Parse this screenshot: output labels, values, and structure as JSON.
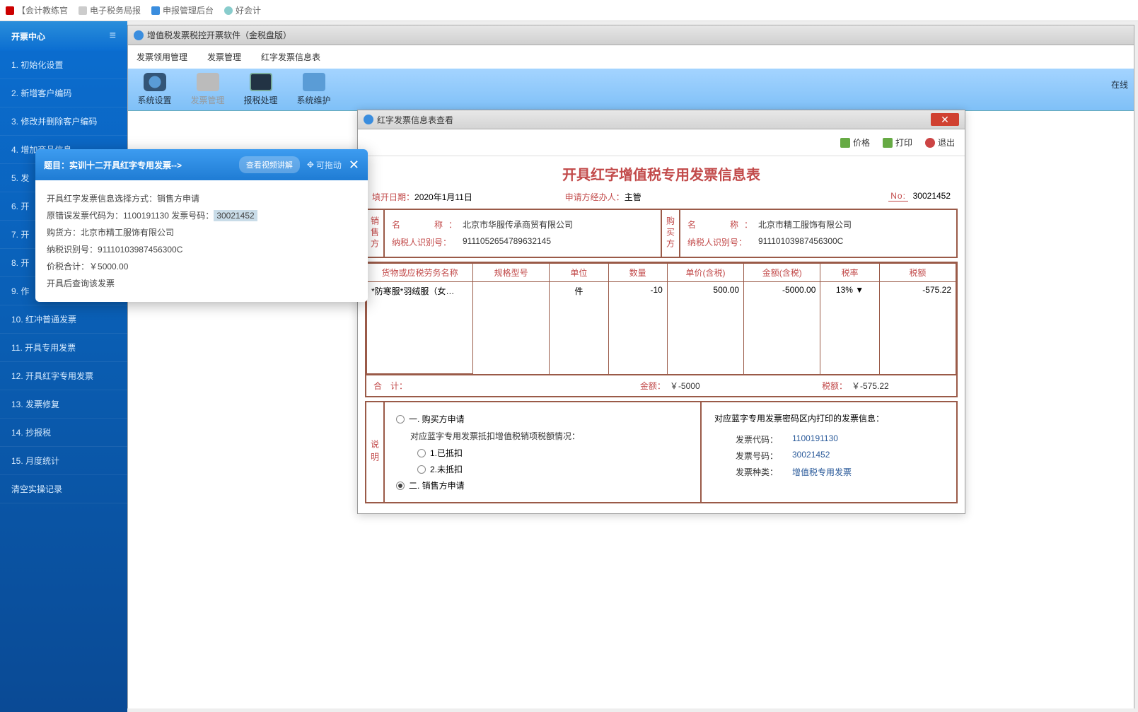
{
  "browserTabs": [
    "【会计教练官",
    "电子税务局报",
    "申报管理后台",
    "好会计"
  ],
  "sidebar": {
    "title": "开票中心",
    "items": [
      "1. 初始化设置",
      "2. 新增客户编码",
      "3. 修改并删除客户编码",
      "4. 增加商品信息",
      "5. 发",
      "6. 开",
      "7. 开",
      "8. 开",
      "9. 作",
      "10. 红冲普通发票",
      "11. 开具专用发票",
      "12. 开具红字专用发票",
      "13. 发票修复",
      "14. 抄报税",
      "15. 月度统计",
      "清空实操记录"
    ]
  },
  "innerWindow": {
    "title": "增值税发票税控开票软件（金税盘版）",
    "menus": [
      "发票领用管理",
      "发票管理",
      "红字发票信息表"
    ]
  },
  "toolbar": {
    "items": [
      "系统设置",
      "发票管理",
      "报税处理",
      "系统维护"
    ],
    "status": "在线"
  },
  "instruction": {
    "title": "题目：实训十二开具红字专用发票-->",
    "viewBtn": "查看视频讲解",
    "dragHint": "可拖动",
    "lines": {
      "l1a": "开具红字发票信息选择方式：",
      "l1b": "销售方申请",
      "l2a": "原错误发票代码为：",
      "l2b": "1100191130 发票号码：",
      "l2c": "30021452",
      "l3a": "购货方：",
      "l3b": "北京市精工服饰有限公司",
      "l4a": "纳税识别号：",
      "l4b": "91110103987456300C",
      "l5a": "价税合计：",
      "l5b": "￥5000.00",
      "l6": "开具后查询该发票"
    }
  },
  "modal": {
    "title": "红字发票信息表查看",
    "btns": {
      "price": "价格",
      "print": "打印",
      "exit": "退出"
    },
    "fapiaoTitle": "开具红字增值税专用发票信息表",
    "top": {
      "dateLabel": "填开日期：",
      "dateValue": "2020年1月11日",
      "applicantLabel": "申请方经办人：",
      "applicantValue": "主管",
      "noLabel": "No:",
      "noValue": "30021452"
    },
    "parties": {
      "seller": {
        "side": "销售方",
        "nameLabel": "名　　称：",
        "name": "北京市华服传承商贸有限公司",
        "taxLabel": "纳税人识别号：",
        "tax": "9111052654789632145"
      },
      "buyer": {
        "side": "购买方",
        "nameLabel": "名　　称：",
        "name": "北京市精工服饰有限公司",
        "taxLabel": "纳税人识别号：",
        "tax": "91110103987456300C"
      }
    },
    "itemsHeader": [
      "货物或应税劳务名称",
      "规格型号",
      "单位",
      "数量",
      "单价(含税)",
      "金额(含税)",
      "税率",
      "税额"
    ],
    "items": [
      {
        "name": "*防寒服*羽绒服（女…",
        "spec": "",
        "unit": "件",
        "qty": "-10",
        "price": "500.00",
        "amount": "-5000.00",
        "rate": "13% ▼",
        "tax": "-575.22"
      }
    ],
    "total": {
      "label": "合　计：",
      "amountLabel": "金额：",
      "amount": "￥-5000",
      "taxLabel": "税额：",
      "tax": "￥-575.22"
    },
    "explain": {
      "side": "说明",
      "opt1": "一. 购买方申请",
      "subText": "对应蓝字专用发票抵扣增值税销项税额情况：",
      "opt1a": "1.已抵扣",
      "opt1b": "2.未抵扣",
      "opt2": "二. 销售方申请",
      "rightTitle": "对应蓝字专用发票密码区内打印的发票信息：",
      "info": {
        "codeLabel": "发票代码：",
        "code": "1100191130",
        "numLabel": "发票号码：",
        "num": "30021452",
        "typeLabel": "发票种类：",
        "type": "增值税专用发票"
      }
    }
  }
}
